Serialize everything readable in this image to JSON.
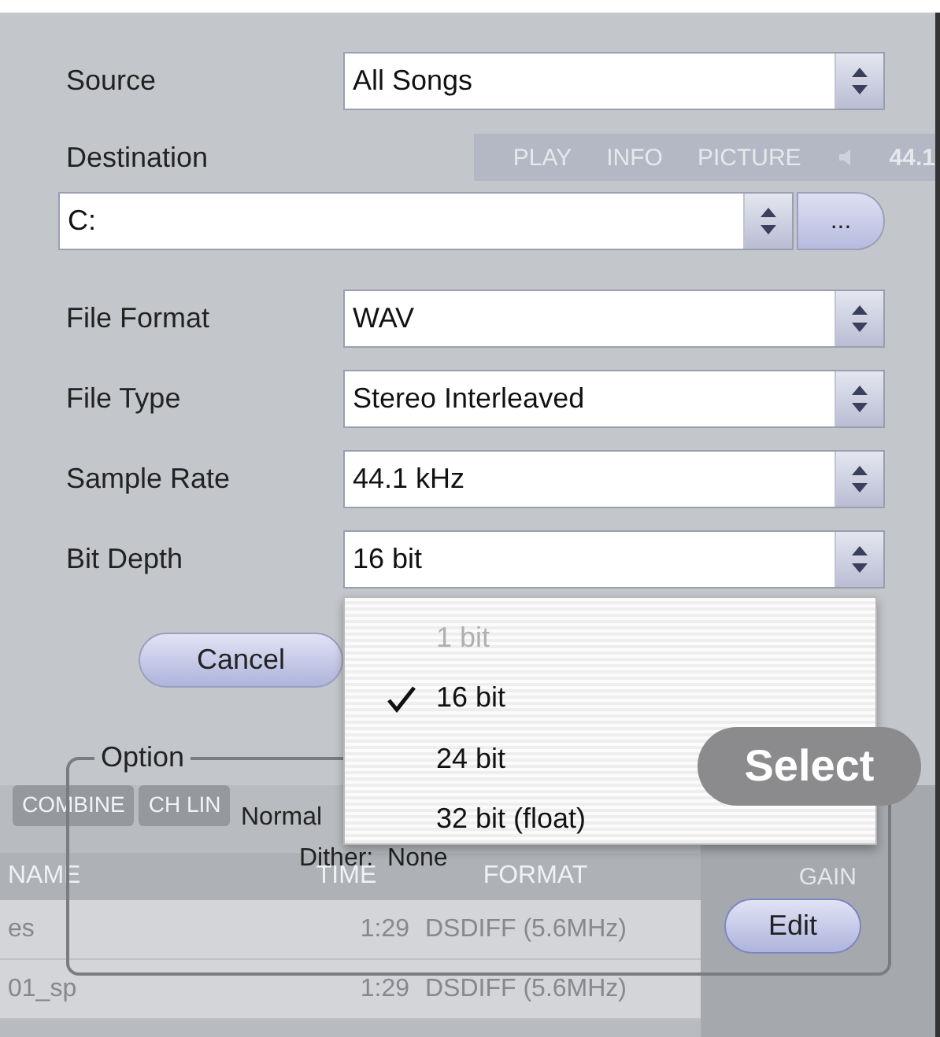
{
  "form": {
    "fields": [
      {
        "kind": "select",
        "label": "Source",
        "value": "All Songs"
      },
      {
        "kind": "path",
        "label": "Destination",
        "value": "C:",
        "browse": "..."
      },
      {
        "kind": "select",
        "label": "File Format",
        "value": "WAV"
      },
      {
        "kind": "select",
        "label": "File Type",
        "value": "Stereo Interleaved"
      },
      {
        "kind": "select",
        "label": "Sample Rate",
        "value": "44.1 kHz"
      },
      {
        "kind": "select",
        "label": "Bit Depth",
        "value": "16 bit"
      }
    ],
    "buttons": [
      "Cancel"
    ]
  },
  "dropdown": {
    "items": [
      {
        "label": "1 bit",
        "selected": false,
        "disabled": true
      },
      {
        "label": "16 bit",
        "selected": true,
        "disabled": false
      },
      {
        "label": "24 bit",
        "selected": false,
        "disabled": false
      },
      {
        "label": "32 bit (float)",
        "selected": false,
        "disabled": false
      }
    ]
  },
  "tooltip": "Select",
  "option": {
    "title": "Option",
    "mode": "Normal",
    "dither": "Dither:  None",
    "button": "Edit"
  },
  "background_app": {
    "tabs": [
      "PLAY",
      "INFO",
      "PICTURE"
    ],
    "rate": "44.1",
    "buttons": [
      "COMBINE",
      "CH LIN"
    ],
    "table": {
      "columns": [
        "NAME",
        "TIME",
        "FORMAT"
      ],
      "rows": [
        [
          "es",
          "1:29",
          "DSDIFF (5.6MHz)"
        ],
        [
          "01_sp",
          "1:29",
          "DSDIFF (5.6MHz)"
        ]
      ]
    },
    "side_label": "GAIN"
  }
}
